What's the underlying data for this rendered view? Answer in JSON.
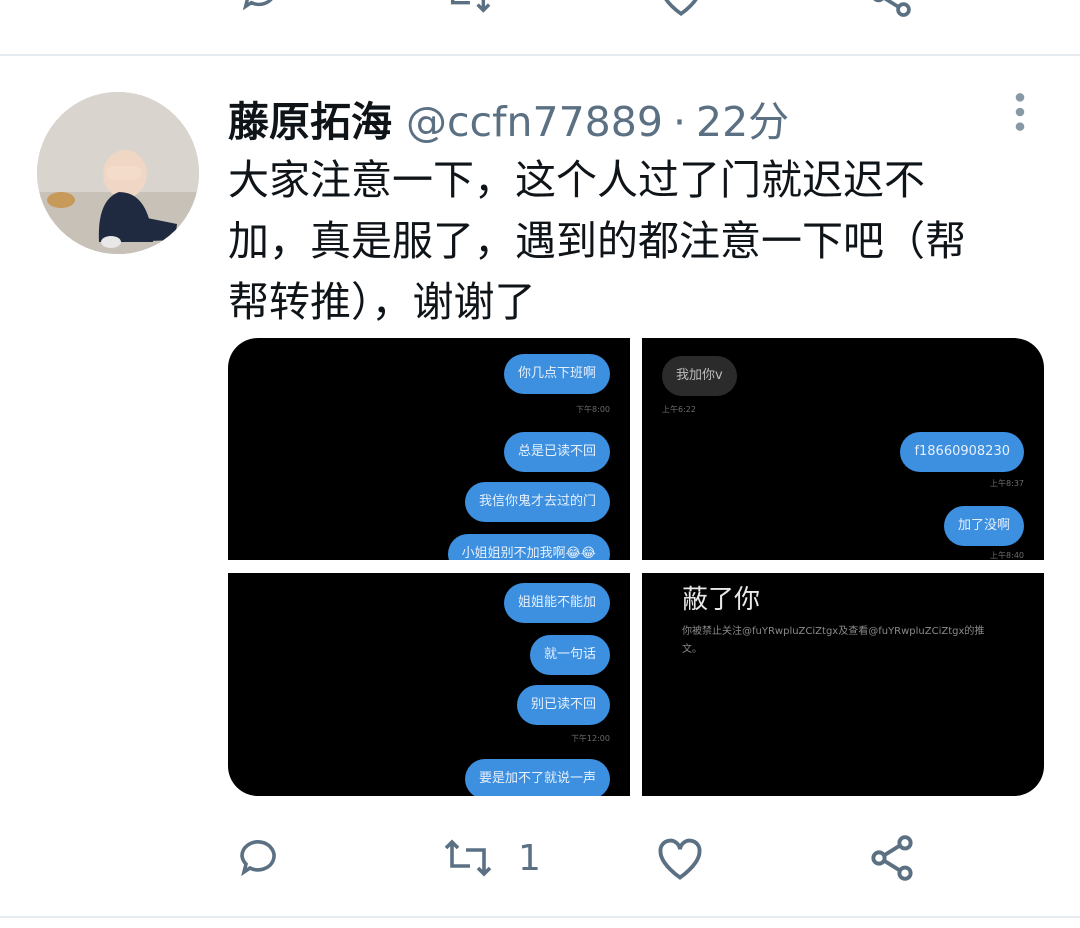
{
  "author": {
    "display_name": "藤原拓海",
    "handle": "@ccfn77889",
    "separator": "·",
    "time": "22分"
  },
  "tweet": {
    "text": "大家注意一下，这个人过了门就迟迟不\n加，真是服了，遇到的都注意一下吧（帮\n帮转推），谢谢了"
  },
  "media": {
    "img1": {
      "bubbles": [
        "你几点下班啊",
        "总是已读不回",
        "我信你鬼才去过的门",
        "小姐姐别不加我啊😂😂"
      ],
      "stamps": [
        "下午8:00"
      ]
    },
    "img2": {
      "bubble_in": "我加你v",
      "bubbles": [
        "f18660908230",
        "加了没啊"
      ],
      "stamps": [
        "上午6:22",
        "上午8:37",
        "上午8:40"
      ]
    },
    "img3": {
      "bubbles": [
        "姐姐能不能加",
        "就一句话",
        "别已读不回",
        "要是加不了就说一声"
      ],
      "stamps": [
        "下午12:00"
      ]
    },
    "img4": {
      "title": "蔽了你",
      "body": "你被禁止关注@fuYRwpluZCiZtgx及查看@fuYRwpluZCiZtgx的推文。"
    }
  },
  "actions": {
    "reply_count": "",
    "retweet_count": "1",
    "like_count": "",
    "share_count": ""
  },
  "colors": {
    "icon_grey": "#5b7083",
    "bubble_blue": "#3d8fe0",
    "divider": "#e6ecf0"
  }
}
